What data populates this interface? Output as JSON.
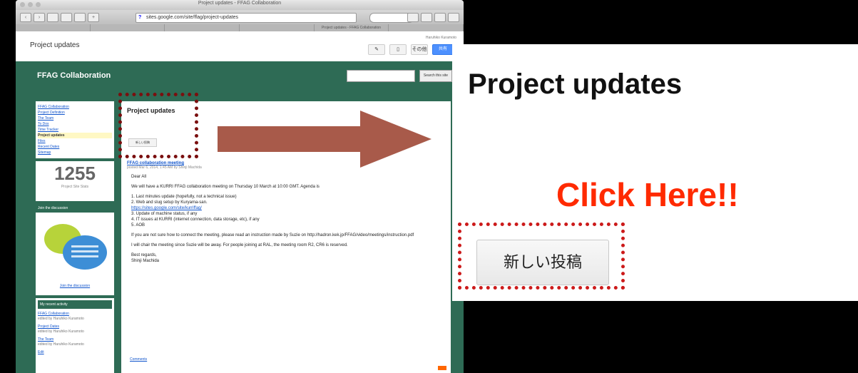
{
  "browser": {
    "window_title": "Project updates - FFAG Collaboration",
    "url": "sites.google.com/site/ffag/project-updates",
    "tabs": [
      "",
      "",
      "",
      "",
      "Project updates - FFAG Collaboration",
      ""
    ]
  },
  "site": {
    "page_title": "Project updates",
    "header_user": "Haruhiko Kuramoto",
    "more_label": "その他",
    "share_label": "共有",
    "site_name": "FFAG Collaboration",
    "search_button": "Search this site"
  },
  "sidebar": {
    "nav_items": [
      {
        "label": "FFAG Collaboration",
        "selected": false
      },
      {
        "label": "Project Definition",
        "selected": false
      },
      {
        "label": "The Team",
        "selected": false
      },
      {
        "label": "To Dos",
        "selected": false
      },
      {
        "label": "Time Tracker",
        "selected": false
      },
      {
        "label": "Project updates",
        "selected": true
      },
      {
        "label": "Files",
        "selected": false
      },
      {
        "label": "Recent Dates",
        "selected": false
      },
      {
        "label": "Sitemap",
        "selected": false
      }
    ],
    "counter_value": "1255",
    "counter_label": "Project Site Stats",
    "chat_header": "Join the discussion",
    "chat_link": "Join the discussion",
    "activity_header": "My recent activity",
    "activity": [
      {
        "title": "FFAG Collaboration",
        "meta": "edited by Haruhiko Kuramoto"
      },
      {
        "title": "Project Dates",
        "meta": "edited by Haruhiko Kuramoto"
      },
      {
        "title": "The Team",
        "meta": "edited by Haruhiko Kuramoto"
      },
      {
        "title": "Edit",
        "meta": ""
      }
    ]
  },
  "content": {
    "title": "Project updates",
    "new_post_small": "新しい投稿",
    "post_title": "FFAG collaboration meeting",
    "post_meta": "posted Mar 6, 2014, 1:45 AM by Shinji Machida",
    "greeting": "Dear All",
    "para1": "We will have a KURRI FFAG collaboration meeting on Thursday 10 March at 10:00 GMT. Agenda is",
    "agenda": [
      "1. Last minutes update (hopefully, not a technical issue)",
      "2. Web and slug setup by Kuryama-san.",
      "https://sites.google.com/site/kurriffag/",
      "3. Update of machine status, if any",
      "4. IT issues at KURRI (internet connection, data storage, etc), if any",
      "5. AOB"
    ],
    "para2": "If you are not sure how to connect the meeting, please read an instruction made by Suzie on http://hadron.kek.jp/FFAG/video/meetings/instruction.pdf",
    "para3": "I will chair the meeting since Suzie will be away. For people joining at RAL, the meeting room R2, CR6 is reserved.",
    "signoff": "Best regards,",
    "signature": "Shinji Machida",
    "comments": "Comments"
  },
  "zoom": {
    "title": "Project updates",
    "callout": "Click Here!!",
    "new_post_button": "新しい投稿"
  },
  "colors": {
    "site_green": "#2e6b55",
    "arrow": "#a85a4a",
    "callout_red": "#ff2a00",
    "dashed_red": "#cc1a1a"
  }
}
